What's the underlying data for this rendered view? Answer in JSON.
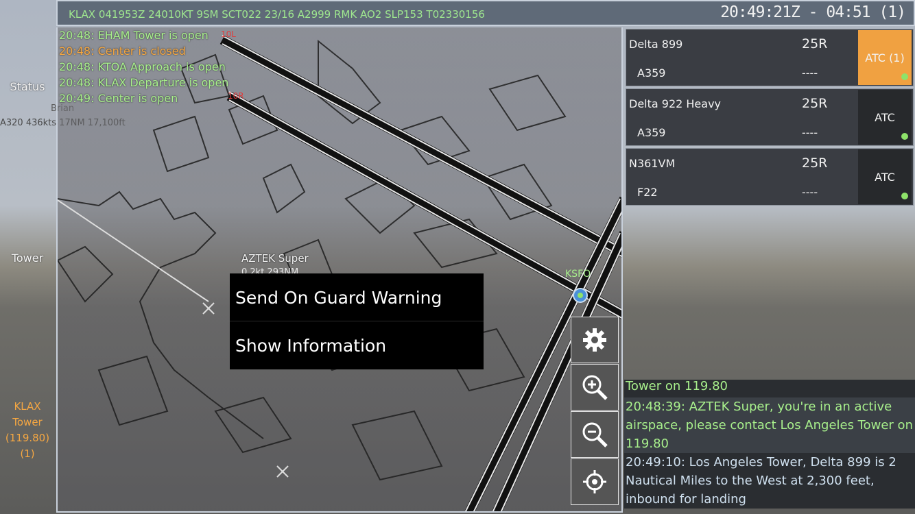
{
  "header": {
    "metar": "KLAX 041953Z 24010KT 9SM SCT022 23/16 A2999 RMK AO2 SLP153 T02330156",
    "clock": "20:49:21Z - 04:51 (1)"
  },
  "left_panel": {
    "status_label": "Status",
    "tower_label": "Tower",
    "traffic_name": "Brian",
    "traffic_info": "A320 436kts 17NM 17,100ft",
    "freq_lines": [
      "KLAX",
      "Tower",
      "(119.80)",
      "(1)"
    ]
  },
  "log": [
    {
      "text": "20:48: EHAM Tower is open",
      "state": "open"
    },
    {
      "text": "20:48:  Center is closed",
      "state": "closed"
    },
    {
      "text": "20:48: KTOA Approach is open",
      "state": "open"
    },
    {
      "text": "20:48: KLAX Departure is open",
      "state": "open"
    },
    {
      "text": "20:49:  Center is open",
      "state": "open"
    }
  ],
  "map": {
    "aircraft_label": "AZTEK Super",
    "aircraft_sub": "0.2kt 293NM",
    "waypoint_label": "KSFO",
    "runway_mark_1": "10L",
    "runway_mark_2": "10R"
  },
  "context_menu": {
    "items": [
      "Send On Guard Warning",
      "Show Information"
    ]
  },
  "tools": [
    "gear-icon",
    "zoom-in-icon",
    "zoom-out-icon",
    "crosshair-icon"
  ],
  "strips": [
    {
      "callsign": "Delta 899",
      "runway": "25R",
      "type": "A359",
      "squawk": "----",
      "atc": "ATC (1)",
      "active": true
    },
    {
      "callsign": "Delta 922 Heavy",
      "runway": "25R",
      "type": "A359",
      "squawk": "----",
      "atc": "ATC",
      "active": false
    },
    {
      "callsign": "N361VM",
      "runway": "25R",
      "type": "F22",
      "squawk": "----",
      "atc": "ATC",
      "active": false
    }
  ],
  "chat": [
    "Tower on 119.80",
    "20:48:39: AZTEK Super, you're in an active airspace,  please contact Los Angeles Tower on 119.80",
    "20:49:10: Los Angeles Tower, Delta 899 is 2 Nautical Miles to the West at 2,300 feet, inbound for landing"
  ],
  "colors": {
    "accent": "#f0a141",
    "green_text": "#a8f08c",
    "online_dot": "#8ee26a"
  }
}
